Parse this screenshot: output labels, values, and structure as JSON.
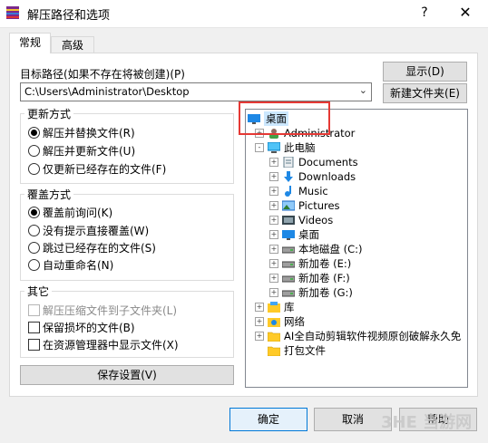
{
  "window": {
    "title": "解压路径和选项",
    "help_glyph": "?",
    "close_glyph": "✕"
  },
  "tabs": [
    {
      "label": "常规",
      "selected": true
    },
    {
      "label": "高级",
      "selected": false
    }
  ],
  "target_path": {
    "label": "目标路径(如果不存在将被创建)(P)",
    "value": "C:\\Users\\Administrator\\Desktop",
    "show_button": "显示(D)",
    "new_folder_button": "新建文件夹(E)"
  },
  "update_mode": {
    "title": "更新方式",
    "options": [
      {
        "label": "解压并替换文件(R)",
        "selected": true
      },
      {
        "label": "解压并更新文件(U)",
        "selected": false
      },
      {
        "label": "仅更新已经存在的文件(F)",
        "selected": false
      }
    ]
  },
  "overwrite_mode": {
    "title": "覆盖方式",
    "options": [
      {
        "label": "覆盖前询问(K)",
        "selected": true
      },
      {
        "label": "没有提示直接覆盖(W)",
        "selected": false
      },
      {
        "label": "跳过已经存在的文件(S)",
        "selected": false
      },
      {
        "label": "自动重命名(N)",
        "selected": false
      }
    ]
  },
  "misc": {
    "title": "其它",
    "options": [
      {
        "label": "解压压缩文件到子文件夹(L)",
        "checked": false,
        "disabled": true
      },
      {
        "label": "保留损坏的文件(B)",
        "checked": false,
        "disabled": false
      },
      {
        "label": "在资源管理器中显示文件(X)",
        "checked": false,
        "disabled": false
      }
    ]
  },
  "save_settings_button": "保存设置(V)",
  "tree": [
    {
      "label": "桌面",
      "icon": "desktop-icon",
      "level": 0,
      "expander": "",
      "selected": true
    },
    {
      "label": "Administrator",
      "icon": "user-icon",
      "level": 1,
      "expander": "+"
    },
    {
      "label": "此电脑",
      "icon": "computer-icon",
      "level": 1,
      "expander": "-"
    },
    {
      "label": "Documents",
      "icon": "documents-icon",
      "level": 2,
      "expander": "+"
    },
    {
      "label": "Downloads",
      "icon": "downloads-icon",
      "level": 2,
      "expander": "+"
    },
    {
      "label": "Music",
      "icon": "music-icon",
      "level": 2,
      "expander": "+"
    },
    {
      "label": "Pictures",
      "icon": "pictures-icon",
      "level": 2,
      "expander": "+"
    },
    {
      "label": "Videos",
      "icon": "videos-icon",
      "level": 2,
      "expander": "+"
    },
    {
      "label": "桌面",
      "icon": "desktop-icon",
      "level": 2,
      "expander": "+"
    },
    {
      "label": "本地磁盘 (C:)",
      "icon": "drive-icon",
      "level": 2,
      "expander": "+"
    },
    {
      "label": "新加卷 (E:)",
      "icon": "drive-icon",
      "level": 2,
      "expander": "+"
    },
    {
      "label": "新加卷 (F:)",
      "icon": "drive-icon",
      "level": 2,
      "expander": "+"
    },
    {
      "label": "新加卷 (G:)",
      "icon": "drive-icon",
      "level": 2,
      "expander": "+"
    },
    {
      "label": "库",
      "icon": "library-icon",
      "level": 1,
      "expander": "+"
    },
    {
      "label": "网络",
      "icon": "network-icon",
      "level": 1,
      "expander": "+"
    },
    {
      "label": "AI全自动剪辑软件视频原创破解永久免",
      "icon": "folder-icon",
      "level": 1,
      "expander": "+"
    },
    {
      "label": "打包文件",
      "icon": "folder-icon",
      "level": 1,
      "expander": ""
    }
  ],
  "buttons": {
    "ok": "确定",
    "cancel": "取消",
    "help": "帮助"
  },
  "watermark": "3HE 当游网",
  "colors": {
    "highlight": "#e53935",
    "ok_border": "#0078d7"
  }
}
